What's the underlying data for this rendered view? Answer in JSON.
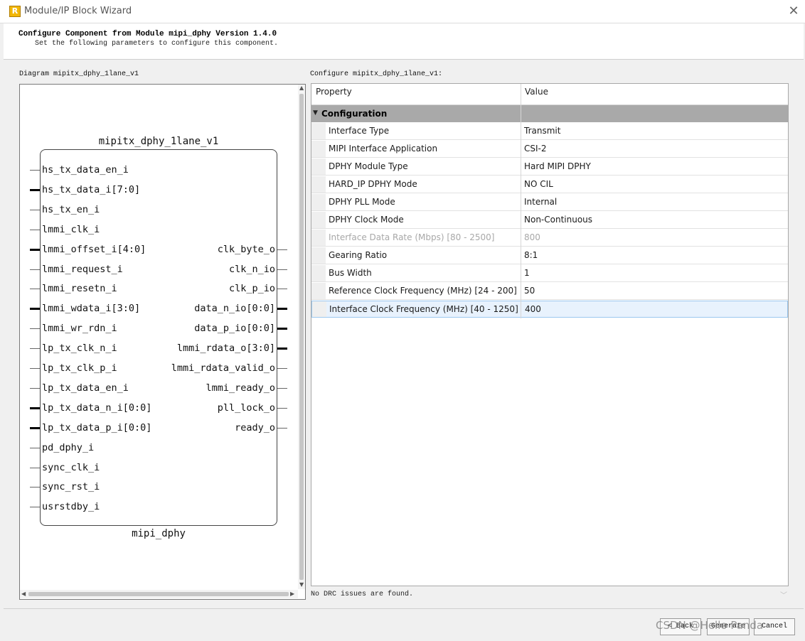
{
  "window": {
    "title": "Module/IP Block Wizard",
    "close_glyph": "✕",
    "app_icon_letter": "R"
  },
  "header": {
    "title": "Configure Component from Module mipi_dphy Version 1.4.0",
    "subtitle": "Set the following parameters to configure this component."
  },
  "diagram": {
    "label": "Diagram mipitx_dphy_1lane_v1",
    "instance_name": "mipitx_dphy_1lane_v1",
    "module_name": "mipi_dphy",
    "left_ports": [
      {
        "name": "hs_tx_data_en_i",
        "bus": false
      },
      {
        "name": "hs_tx_data_i[7:0]",
        "bus": true
      },
      {
        "name": "hs_tx_en_i",
        "bus": false
      },
      {
        "name": "lmmi_clk_i",
        "bus": false
      },
      {
        "name": "lmmi_offset_i[4:0]",
        "bus": true
      },
      {
        "name": "lmmi_request_i",
        "bus": false
      },
      {
        "name": "lmmi_resetn_i",
        "bus": false
      },
      {
        "name": "lmmi_wdata_i[3:0]",
        "bus": true
      },
      {
        "name": "lmmi_wr_rdn_i",
        "bus": false
      },
      {
        "name": "lp_tx_clk_n_i",
        "bus": false
      },
      {
        "name": "lp_tx_clk_p_i",
        "bus": false
      },
      {
        "name": "lp_tx_data_en_i",
        "bus": false
      },
      {
        "name": "lp_tx_data_n_i[0:0]",
        "bus": true
      },
      {
        "name": "lp_tx_data_p_i[0:0]",
        "bus": true
      },
      {
        "name": "pd_dphy_i",
        "bus": false
      },
      {
        "name": "sync_clk_i",
        "bus": false
      },
      {
        "name": "sync_rst_i",
        "bus": false
      },
      {
        "name": "usrstdby_i",
        "bus": false
      }
    ],
    "right_ports": [
      {
        "name": "clk_byte_o",
        "bus": false
      },
      {
        "name": "clk_n_io",
        "bus": false
      },
      {
        "name": "clk_p_io",
        "bus": false
      },
      {
        "name": "data_n_io[0:0]",
        "bus": true
      },
      {
        "name": "data_p_io[0:0]",
        "bus": true
      },
      {
        "name": "lmmi_rdata_o[3:0]",
        "bus": true
      },
      {
        "name": "lmmi_rdata_valid_o",
        "bus": false
      },
      {
        "name": "lmmi_ready_o",
        "bus": false
      },
      {
        "name": "pll_lock_o",
        "bus": false
      },
      {
        "name": "ready_o",
        "bus": false
      }
    ]
  },
  "config": {
    "label": "Configure mipitx_dphy_1lane_v1:",
    "columns": [
      "Property",
      "Value"
    ],
    "category": "Configuration",
    "rows": [
      {
        "property": "Interface Type",
        "value": "Transmit",
        "disabled": false,
        "selected": false
      },
      {
        "property": "MIPI Interface Application",
        "value": "CSI-2",
        "disabled": false,
        "selected": false
      },
      {
        "property": "DPHY Module Type",
        "value": "Hard MIPI DPHY",
        "disabled": false,
        "selected": false
      },
      {
        "property": "HARD_IP DPHY Mode",
        "value": "NO CIL",
        "disabled": false,
        "selected": false
      },
      {
        "property": "DPHY PLL Mode",
        "value": "Internal",
        "disabled": false,
        "selected": false
      },
      {
        "property": "DPHY Clock Mode",
        "value": "Non-Continuous",
        "disabled": false,
        "selected": false
      },
      {
        "property": "Interface Data Rate (Mbps)  [80 - 2500]",
        "value": "800",
        "disabled": true,
        "selected": false
      },
      {
        "property": "Gearing Ratio",
        "value": "8:1",
        "disabled": false,
        "selected": false
      },
      {
        "property": "Bus Width",
        "value": "1",
        "disabled": false,
        "selected": false
      },
      {
        "property": "Reference Clock Frequency (MHz)  [24 - 200]",
        "value": "50",
        "disabled": false,
        "selected": false
      },
      {
        "property": "Interface Clock Frequency (MHz)  [40 - 1250]",
        "value": "400",
        "disabled": false,
        "selected": true
      }
    ],
    "drc_message": "No DRC issues are found."
  },
  "footer": {
    "back": "< Back",
    "generate": "Generate",
    "cancel": "Cancel",
    "watermark": "CSDN @Hello Panda"
  }
}
